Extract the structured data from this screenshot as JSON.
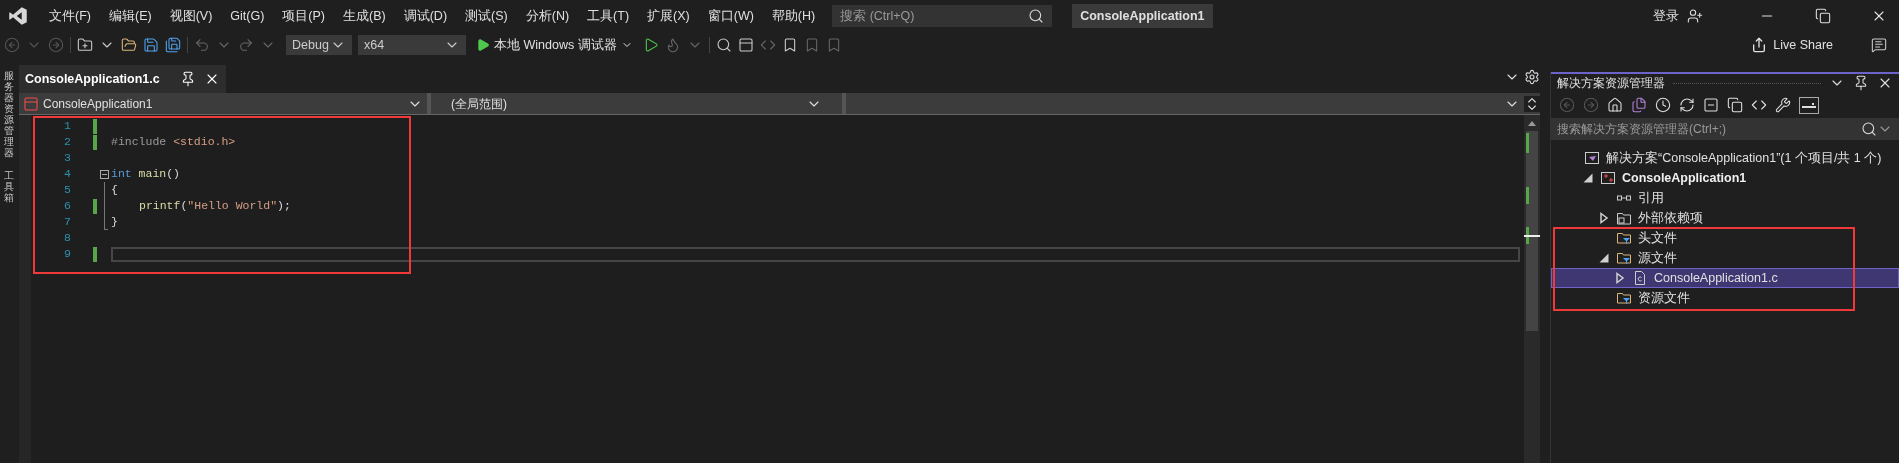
{
  "title_bar": {
    "menu": [
      "文件(F)",
      "编辑(E)",
      "视图(V)",
      "Git(G)",
      "项目(P)",
      "生成(B)",
      "调试(D)",
      "测试(S)",
      "分析(N)",
      "工具(T)",
      "扩展(X)",
      "窗口(W)",
      "帮助(H)"
    ],
    "search": {
      "placeholder": "搜索 (Ctrl+Q)"
    },
    "solution_name": "ConsoleApplication1",
    "sign_in": "登录"
  },
  "toolbar": {
    "configuration": "Debug",
    "platform": "x64",
    "run_label": "本地 Windows 调试器",
    "live_share": "Live Share"
  },
  "side_strip": [
    "服务器资源管理器",
    "工具箱"
  ],
  "editor": {
    "tabs": [
      {
        "label": "ConsoleApplication1.c",
        "selected": true
      }
    ],
    "nav": [
      "ConsoleApplication1",
      "(全局范围)"
    ],
    "lines": [
      {
        "number": "1",
        "changed": true,
        "current": false,
        "collapsible": false,
        "in_block": false
      },
      {
        "number": "2",
        "changed": true,
        "current": false,
        "collapsible": false,
        "in_block": false,
        "tokens": [
          {
            "kind": "directive",
            "text": "#include "
          },
          {
            "kind": "string",
            "text": "<stdio.h>"
          }
        ]
      },
      {
        "number": "3",
        "changed": false,
        "current": false,
        "collapsible": false,
        "in_block": false
      },
      {
        "number": "4",
        "changed": false,
        "current": false,
        "collapsible": true,
        "in_block": false,
        "tokens": [
          {
            "kind": "keyword",
            "text": "int "
          },
          {
            "kind": "function",
            "text": "main"
          },
          {
            "kind": "plain",
            "text": "()"
          }
        ]
      },
      {
        "number": "5",
        "changed": false,
        "current": false,
        "collapsible": false,
        "in_block": true,
        "tokens": [
          {
            "kind": "plain",
            "text": "{"
          }
        ]
      },
      {
        "number": "6",
        "changed": true,
        "current": false,
        "collapsible": false,
        "in_block": true,
        "tokens": [
          {
            "kind": "function",
            "text": "printf"
          },
          {
            "kind": "plain",
            "text": "("
          },
          {
            "kind": "string",
            "text": "\"Hello World\""
          },
          {
            "kind": "plain",
            "text": ");"
          }
        ]
      },
      {
        "number": "7",
        "changed": false,
        "current": false,
        "collapsible": false,
        "in_block": true,
        "tokens": [
          {
            "kind": "plain",
            "text": "}"
          }
        ]
      },
      {
        "number": "8",
        "changed": false,
        "current": false,
        "collapsible": false,
        "in_block": false
      },
      {
        "number": "9",
        "changed": true,
        "current": true,
        "collapsible": false,
        "in_block": false
      }
    ]
  },
  "solution_explorer": {
    "title": "解决方案资源管理器",
    "search": {
      "placeholder": "搜索解决方案资源管理器(Ctrl+;)"
    },
    "tree": [
      {
        "kind": "solution",
        "label": "解决方案“ConsoleApplication1”(1 个项目/共 1 个)",
        "selected": false,
        "children": [
          {
            "kind": "project",
            "label": "ConsoleApplication1",
            "expanded": true,
            "selected": false,
            "children": [
              {
                "kind": "references",
                "label": "引用",
                "selected": false
              },
              {
                "kind": "external",
                "label": "外部依赖项",
                "expanded": false,
                "selected": false
              },
              {
                "kind": "filter",
                "label": "头文件",
                "selected": false
              },
              {
                "kind": "filter",
                "label": "源文件",
                "expanded": true,
                "selected": false,
                "children": [
                  {
                    "kind": "file",
                    "label": "ConsoleApplication1.c",
                    "expanded": false,
                    "selected": true
                  }
                ]
              },
              {
                "kind": "filter",
                "label": "资源文件",
                "selected": false
              }
            ]
          }
        ]
      }
    ]
  }
}
